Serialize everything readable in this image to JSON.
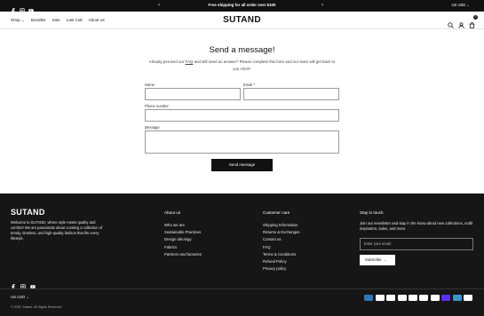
{
  "topbar": {
    "announcement": "Free shipping for all order over $100",
    "currency": "US USD",
    "social_icons": [
      "facebook-icon",
      "instagram-icon",
      "youtube-icon"
    ],
    "prev_arrow": "‹",
    "next_arrow": "›",
    "chevron": "⌄"
  },
  "header": {
    "logo": "SUTAND",
    "nav": [
      {
        "label": "Shop ⌄"
      },
      {
        "label": "Bundles"
      },
      {
        "label": "Sale"
      },
      {
        "label": "Last Call"
      },
      {
        "label": "About us"
      }
    ],
    "icons": [
      "search-icon",
      "account-icon",
      "cart-icon"
    ],
    "cart_count": "0"
  },
  "form": {
    "title": "Send a message!",
    "intro_before": "Already perused our ",
    "intro_link": "FAQ",
    "intro_after": " and still need an answer? Please complete this form and our team will get back to you ASAP.",
    "name_label": "Name",
    "email_label": "Email *",
    "phone_label": "Phone number",
    "message_label": "Message",
    "name_value": "",
    "email_value": "",
    "phone_value": "",
    "message_value": "",
    "submit_label": "Send message"
  },
  "footer": {
    "logo": "SUTAND",
    "description": "Welcome to SUTAND, where style meets quality and comfort! We are passionate about curating a collection of trendy, timeless, and high-quality fashion that fits every lifestyle.",
    "about": {
      "heading": "About us",
      "links": [
        "Who we are",
        "Sustainable Practices",
        "Design ideology",
        "Fabrics",
        "Partners and factories"
      ]
    },
    "care": {
      "heading": "Customer care",
      "links": [
        "Shipping Information",
        "Returns & Exchanges",
        "Contact us",
        "FAQ",
        "Terms & Conditions",
        "Refund Policy",
        "Privacy policy"
      ]
    },
    "newsletter": {
      "heading": "Stay in touch",
      "text": "Join our newsletter and stay in the know about new collections, outfit inspiration, sales, and more.",
      "placeholder": "Enter your email",
      "button_label": "Subscribe →"
    },
    "currency": "US USD ⌄",
    "copyright": "© 2025, Sutand. All Rights Reserved.",
    "payments": [
      {
        "name": "amex-icon",
        "color": "#2e77bc"
      },
      {
        "name": "apple-pay-icon",
        "color": "#ffffff"
      },
      {
        "name": "diners-club-icon",
        "color": "#ffffff"
      },
      {
        "name": "discover-icon",
        "color": "#ffffff"
      },
      {
        "name": "google-pay-icon",
        "color": "#ffffff"
      },
      {
        "name": "mastercard-icon",
        "color": "#ffffff"
      },
      {
        "name": "paypal-icon",
        "color": "#ffffff"
      },
      {
        "name": "shop-pay-icon",
        "color": "#5a31f4"
      },
      {
        "name": "venmo-icon",
        "color": "#3d95ce"
      },
      {
        "name": "visa-icon",
        "color": "#ffffff"
      }
    ]
  }
}
